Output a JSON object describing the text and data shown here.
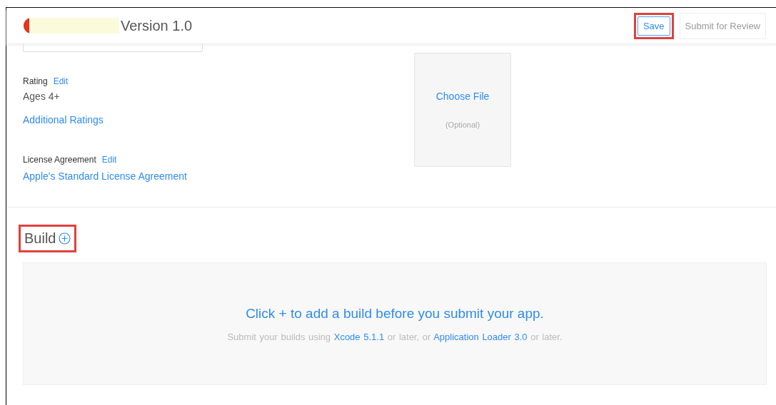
{
  "header": {
    "title": "Version 1.0",
    "redacted": true,
    "buttons": [
      {
        "label": "Save",
        "disabled": false,
        "highlighted": true
      },
      {
        "label": "Submit for Review",
        "disabled": true,
        "highlighted": false
      }
    ]
  },
  "left": {
    "rating": {
      "label": "Rating",
      "edit": "Edit",
      "value": "Ages 4+",
      "link": "Additional Ratings"
    },
    "license": {
      "label": "License Agreement",
      "edit": "Edit",
      "link": "Apple's Standard License Agreement"
    }
  },
  "upload": {
    "action": "Choose File",
    "note": "(Optional)"
  },
  "build": {
    "title": "Build",
    "highlighted": true,
    "message": "Click + to add a build before you submit your app.",
    "hint": [
      {
        "kind": "text",
        "text": "Submit your builds using"
      },
      {
        "kind": "link",
        "text": "Xcode 5.1.1"
      },
      {
        "kind": "text",
        "text": "or later, or"
      },
      {
        "kind": "link",
        "text": "Application Loader 3.0"
      },
      {
        "kind": "text",
        "text": "or later."
      }
    ]
  }
}
